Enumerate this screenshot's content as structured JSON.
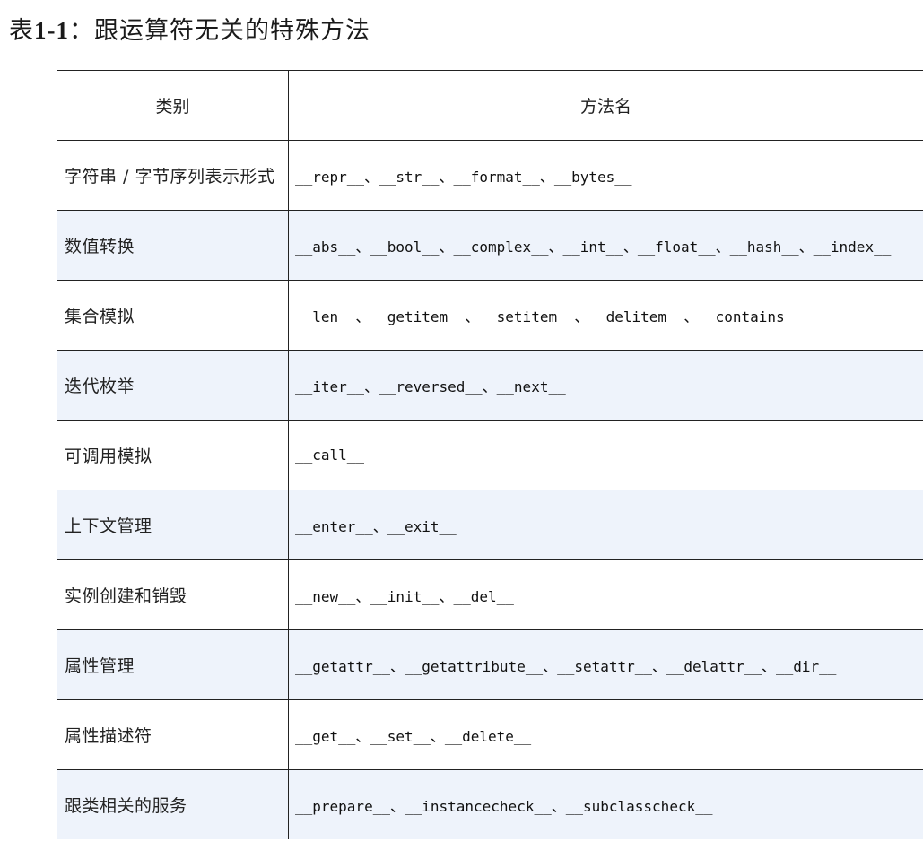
{
  "caption": {
    "prefix": "表",
    "number": "1-1",
    "text": "：跟运算符无关的特殊方法"
  },
  "table": {
    "headers": [
      "类别",
      "方法名"
    ],
    "rows": [
      {
        "category": "字符串 / 字节序列表示形式",
        "methods": "__repr__、__str__、__format__、__bytes__"
      },
      {
        "category": "数值转换",
        "methods": "__abs__、__bool__、__complex__、__int__、__float__、__hash__、__index__"
      },
      {
        "category": "集合模拟",
        "methods": "__len__、__getitem__、__setitem__、__delitem__、__contains__"
      },
      {
        "category": "迭代枚举",
        "methods": "__iter__、__reversed__、__next__"
      },
      {
        "category": "可调用模拟",
        "methods": "__call__"
      },
      {
        "category": "上下文管理",
        "methods": "__enter__、__exit__"
      },
      {
        "category": "实例创建和销毁",
        "methods": "__new__、__init__、__del__"
      },
      {
        "category": "属性管理",
        "methods": "__getattr__、__getattribute__、__setattr__、__delattr__、__dir__"
      },
      {
        "category": "属性描述符",
        "methods": "__get__、__set__、__delete__"
      },
      {
        "category": "跟类相关的服务",
        "methods": "__prepare__、__instancecheck__、__subclasscheck__"
      }
    ]
  },
  "colors": {
    "alt_row_background": "#eef3fb",
    "border": "#222222"
  }
}
